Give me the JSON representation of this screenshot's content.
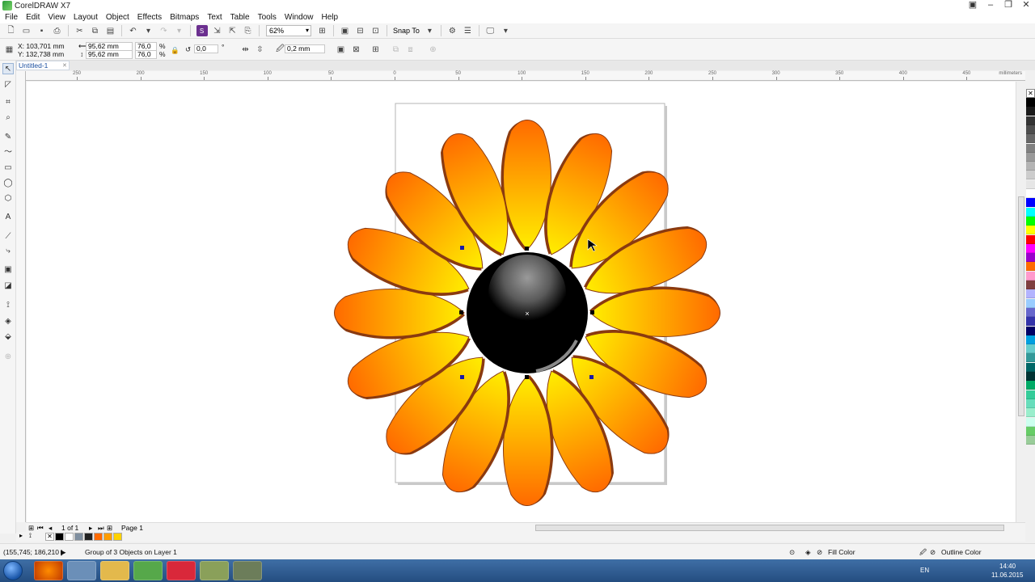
{
  "window": {
    "title": "CorelDRAW X7"
  },
  "menu": [
    "File",
    "Edit",
    "View",
    "Layout",
    "Object",
    "Effects",
    "Bitmaps",
    "Text",
    "Table",
    "Tools",
    "Window",
    "Help"
  ],
  "toolbar": {
    "zoom_value": "62%",
    "snap_label": "Snap To"
  },
  "property_bar": {
    "x_pos": "X: 103,701 mm",
    "y_pos": "Y: 132,738 mm",
    "width": "95,62 mm",
    "height": "95,62 mm",
    "scale_x": "76,0",
    "scale_y": "76,0",
    "percent": "%",
    "angle": "0,0",
    "degree": "°",
    "outline_width": "0,2 mm"
  },
  "document_tab": "Untitled-1",
  "ruler": {
    "top_labels": [
      "250",
      "200",
      "150",
      "100",
      "50",
      "0",
      "50",
      "100",
      "150",
      "200",
      "250",
      "300",
      "350",
      "400",
      "450"
    ],
    "unit": "millimeters"
  },
  "page_nav": {
    "page_count": "1 of 1",
    "page_name": "Page 1"
  },
  "status": {
    "coordinates": "(155,745; 186,210 )",
    "selection_info": "Group of 3 Objects on Layer 1",
    "fill_label": "Fill Color",
    "outline_label": "Outline Color"
  },
  "taskbar": {
    "language": "EN",
    "time": "14:40",
    "date": "11.06.2015"
  },
  "colors": {
    "petal_light": "#ffee00",
    "petal_dark": "#ff6a00",
    "petal_outline": "#8a3a10",
    "center": "#000000",
    "selection": "#1a1aa6"
  }
}
